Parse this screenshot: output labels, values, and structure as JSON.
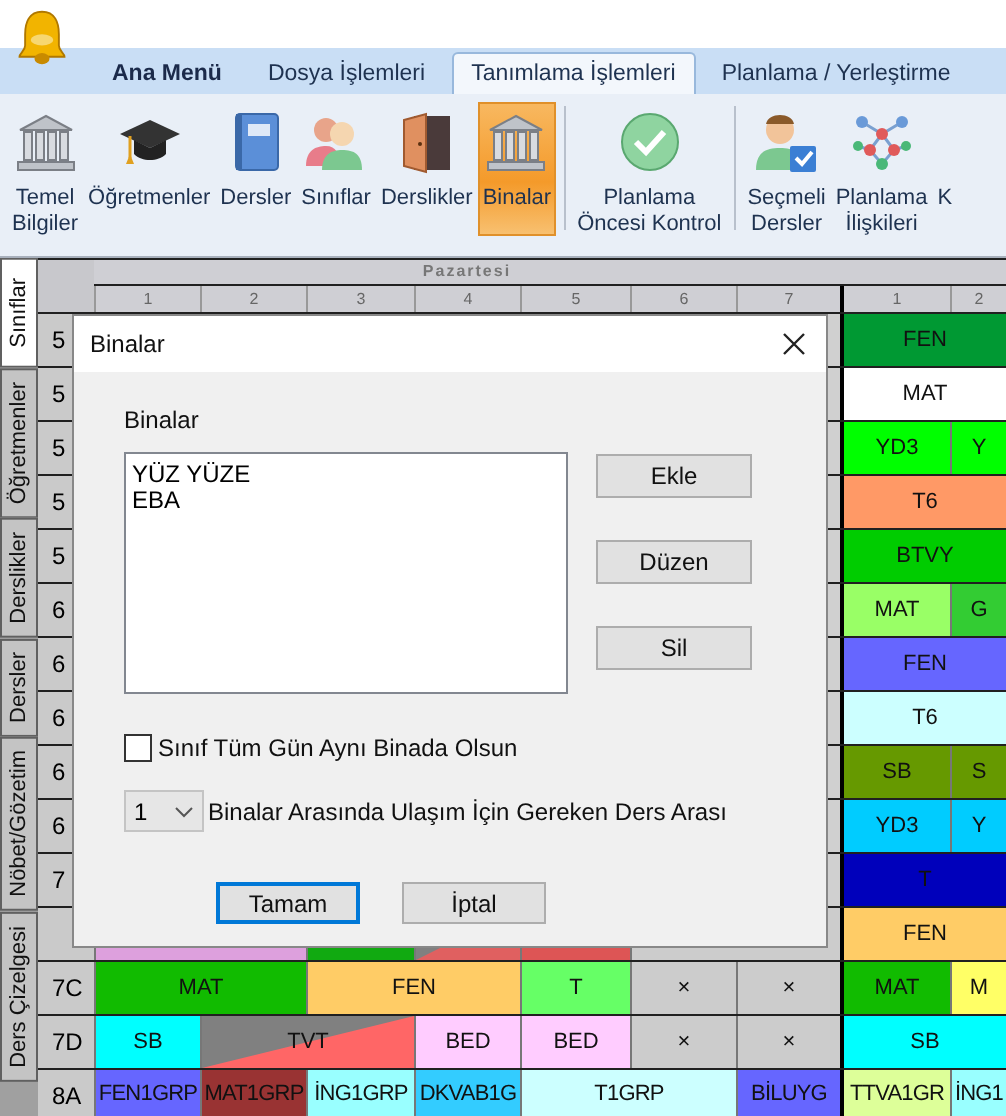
{
  "tabs": [
    {
      "label": "Ana Menü",
      "kind": "home",
      "selected": false
    },
    {
      "label": "Dosya İşlemleri",
      "kind": "tab",
      "selected": false
    },
    {
      "label": "Tanımlama İşlemleri",
      "kind": "tab",
      "selected": true
    },
    {
      "label": "Planlama / Yerleştirme",
      "kind": "tab",
      "selected": false
    }
  ],
  "ribbon": [
    {
      "label": "Temel\nBilgiler",
      "kind": "building",
      "selected": false,
      "separator_before": false
    },
    {
      "label": "Öğretmenler",
      "kind": "cap",
      "selected": false,
      "separator_before": false
    },
    {
      "label": "Dersler",
      "kind": "book",
      "selected": false,
      "separator_before": false
    },
    {
      "label": "Sınıflar",
      "kind": "people",
      "selected": false,
      "separator_before": false
    },
    {
      "label": "Derslikler",
      "kind": "door",
      "selected": false,
      "separator_before": false
    },
    {
      "label": "Binalar",
      "kind": "building",
      "selected": true,
      "separator_before": false
    },
    {
      "label": "Planlama\nÖncesi Kontrol",
      "kind": "check",
      "selected": false,
      "separator_before": true
    },
    {
      "label": "Seçmeli\nDersler",
      "kind": "person",
      "selected": false,
      "separator_before": true
    },
    {
      "label": "Planlama\nİlişkileri",
      "kind": "network",
      "selected": false,
      "separator_before": false
    },
    {
      "label": "K",
      "kind": "cut",
      "selected": false,
      "separator_before": false
    }
  ],
  "side_tabs": [
    {
      "label": "Sınıflar",
      "selected": true
    },
    {
      "label": "Öğretmenler",
      "selected": false
    },
    {
      "label": "Derslikler",
      "selected": false
    },
    {
      "label": "Dersler",
      "selected": false
    },
    {
      "label": "Nöbet/Gözetim",
      "selected": false
    },
    {
      "label": "Ders Çizelgesi",
      "selected": false
    }
  ],
  "grid": {
    "days": [
      {
        "label": "Pazartesi",
        "periods": [
          "1",
          "2",
          "3",
          "4",
          "5",
          "6",
          "7"
        ]
      },
      {
        "periods": [
          "1",
          "2"
        ]
      }
    ],
    "rows": [
      {
        "label": "5",
        "left": [],
        "right": [
          {
            "text": "FEN",
            "color": "#009933",
            "kind": "double"
          }
        ]
      },
      {
        "label": "5",
        "left": [],
        "right": [
          {
            "text": "MAT",
            "color": "#ffffff",
            "kind": "double"
          }
        ]
      },
      {
        "label": "5",
        "left": [],
        "right": [
          {
            "text": "YD3",
            "color": "#00ff00",
            "kind": "single"
          },
          {
            "text": "Y",
            "color": "#00ff00",
            "kind": "single"
          }
        ]
      },
      {
        "label": "5",
        "left": [],
        "right": [
          {
            "text": "T6",
            "color": "#ff9966",
            "kind": "double"
          }
        ]
      },
      {
        "label": "5",
        "left": [],
        "right": [
          {
            "text": "BTVY",
            "color": "#00cc00",
            "kind": "double"
          }
        ]
      },
      {
        "label": "6",
        "left": [],
        "right": [
          {
            "text": "MAT",
            "color": "#99ff66",
            "kind": "single"
          },
          {
            "text": "G",
            "color": "#33cc33",
            "kind": "single"
          }
        ]
      },
      {
        "label": "6",
        "left": [],
        "right": [
          {
            "text": "FEN",
            "color": "#6666ff",
            "kind": "double"
          }
        ]
      },
      {
        "label": "6",
        "left": [],
        "right": [
          {
            "text": "T6",
            "color": "#ccffff",
            "kind": "double"
          }
        ]
      },
      {
        "label": "6",
        "left": [],
        "right": [
          {
            "text": "SB",
            "color": "#669900",
            "kind": "single"
          },
          {
            "text": "S",
            "color": "#669900",
            "kind": "single"
          }
        ]
      },
      {
        "label": "6",
        "left": [],
        "right": [
          {
            "text": "YD3",
            "color": "#00ccff",
            "kind": "single"
          },
          {
            "text": "Y",
            "color": "#00ccff",
            "kind": "single"
          }
        ]
      },
      {
        "label": "7",
        "left": [],
        "right": [
          {
            "text": "T",
            "color": "#0000bb",
            "kind": "double"
          }
        ]
      },
      {
        "left": [
          {
            "color": "#dda0dd",
            "kind": "double"
          },
          {
            "color": "#11aa11",
            "kind": "single"
          },
          {
            "color": "#808080",
            "split": {
              "color": "#e06060"
            },
            "kind": "single"
          },
          {
            "color": "#dd5555",
            "kind": "single"
          },
          {
            "color": "#cccccc",
            "kind": "double"
          }
        ],
        "right": [
          {
            "text": "FEN",
            "color": "#ffcc66",
            "kind": "double"
          }
        ]
      },
      {
        "label": "7C",
        "left": [
          {
            "text": "MAT",
            "color": "#11bb00",
            "kind": "double"
          },
          {
            "text": "FEN",
            "color": "#ffcc66",
            "kind": "double"
          },
          {
            "text": "T",
            "color": "#66ff66",
            "kind": "single"
          },
          {
            "text": "×",
            "color": "#cccccc",
            "kind": "single"
          },
          {
            "text": "×",
            "color": "#cccccc",
            "kind": "single"
          }
        ],
        "right": [
          {
            "text": "MAT",
            "color": "#11bb00",
            "kind": "single"
          },
          {
            "text": "M",
            "color": "#ffff66",
            "kind": "single"
          }
        ]
      },
      {
        "label": "7D",
        "left": [
          {
            "text": "SB",
            "color": "#00ffff",
            "kind": "single"
          },
          {
            "text": "TVT",
            "color": "#808080",
            "split": {
              "color": "#ff6666"
            },
            "kind": "double"
          },
          {
            "text": "BED",
            "color": "#ffccff",
            "kind": "single"
          },
          {
            "text": "BED",
            "color": "#ffccff",
            "kind": "single"
          },
          {
            "text": "×",
            "color": "#cccccc",
            "kind": "single"
          },
          {
            "text": "×",
            "color": "#cccccc",
            "kind": "single"
          }
        ],
        "right": [
          {
            "text": "SB",
            "color": "#00ffff",
            "kind": "double"
          }
        ]
      },
      {
        "label": "8A",
        "left": [
          {
            "text": "FEN1GRP",
            "color": "#6666ff",
            "kind": "single"
          },
          {
            "text": "MAT1GRP",
            "color": "#993333",
            "kind": "single"
          },
          {
            "text": "İNG1GRP",
            "color": "#99ffff",
            "kind": "single"
          },
          {
            "text": "DKVAB1G",
            "color": "#33ccff",
            "kind": "single"
          },
          {
            "text": "T1GRP",
            "color": "#ccffff",
            "kind": "double"
          },
          {
            "text": "BİLUYG",
            "color": "#6666ff",
            "kind": "single"
          }
        ],
        "right": [
          {
            "text": "TTVA1GR",
            "color": "#ddff99",
            "kind": "single"
          },
          {
            "text": "İNG1",
            "color": "#99ffff",
            "kind": "single"
          }
        ]
      }
    ]
  },
  "dialog": {
    "title": "Binalar",
    "list_label": "Binalar",
    "items": [
      "YÜZ YÜZE",
      "EBA"
    ],
    "side_buttons": [
      "Ekle",
      "Düzen",
      "Sil"
    ],
    "checkbox": {
      "label": "Sınıf Tüm Gün Aynı Binada Olsun",
      "checked": false
    },
    "combo": {
      "value": "1",
      "label": "Binalar Arasında Ulaşım İçin Gereken Ders Arası"
    },
    "buttons": [
      {
        "label": "Tamam",
        "focused": true
      },
      {
        "label": "İptal",
        "focused": false
      }
    ]
  }
}
